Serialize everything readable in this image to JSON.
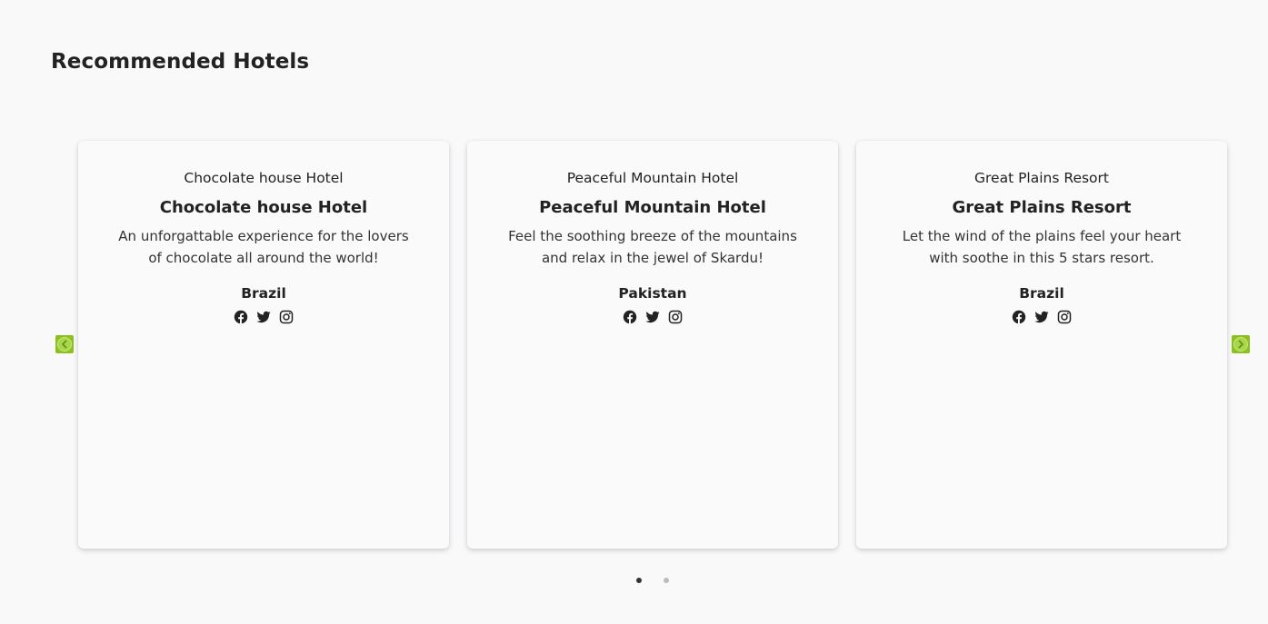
{
  "section": {
    "title": "Recommended Hotels"
  },
  "hotels": [
    {
      "subtitle": "Chocolate house Hotel",
      "name": "Chocolate house Hotel",
      "description": "An unforgattable experience for the lovers of chocolate all around the world!",
      "country": "Brazil"
    },
    {
      "subtitle": "Peaceful Mountain Hotel",
      "name": "Peaceful Mountain Hotel",
      "description": "Feel the soothing breeze of the mountains and relax in the jewel of Skardu!",
      "country": "Pakistan"
    },
    {
      "subtitle": "Great Plains Resort",
      "name": "Great Plains Resort",
      "description": "Let the wind of the plains feel your heart with soothe in this 5 stars resort.",
      "country": "Brazil"
    }
  ],
  "social_icons": [
    "facebook-icon",
    "twitter-icon",
    "instagram-icon"
  ],
  "carousel": {
    "prev_icon": "chevron-left-icon",
    "next_icon": "chevron-right-icon",
    "page_count": 2,
    "active_page": 1
  },
  "colors": {
    "accent": "#8cc11d",
    "background": "#f9f9fa",
    "card": "#fafafa",
    "text": "#222222"
  }
}
